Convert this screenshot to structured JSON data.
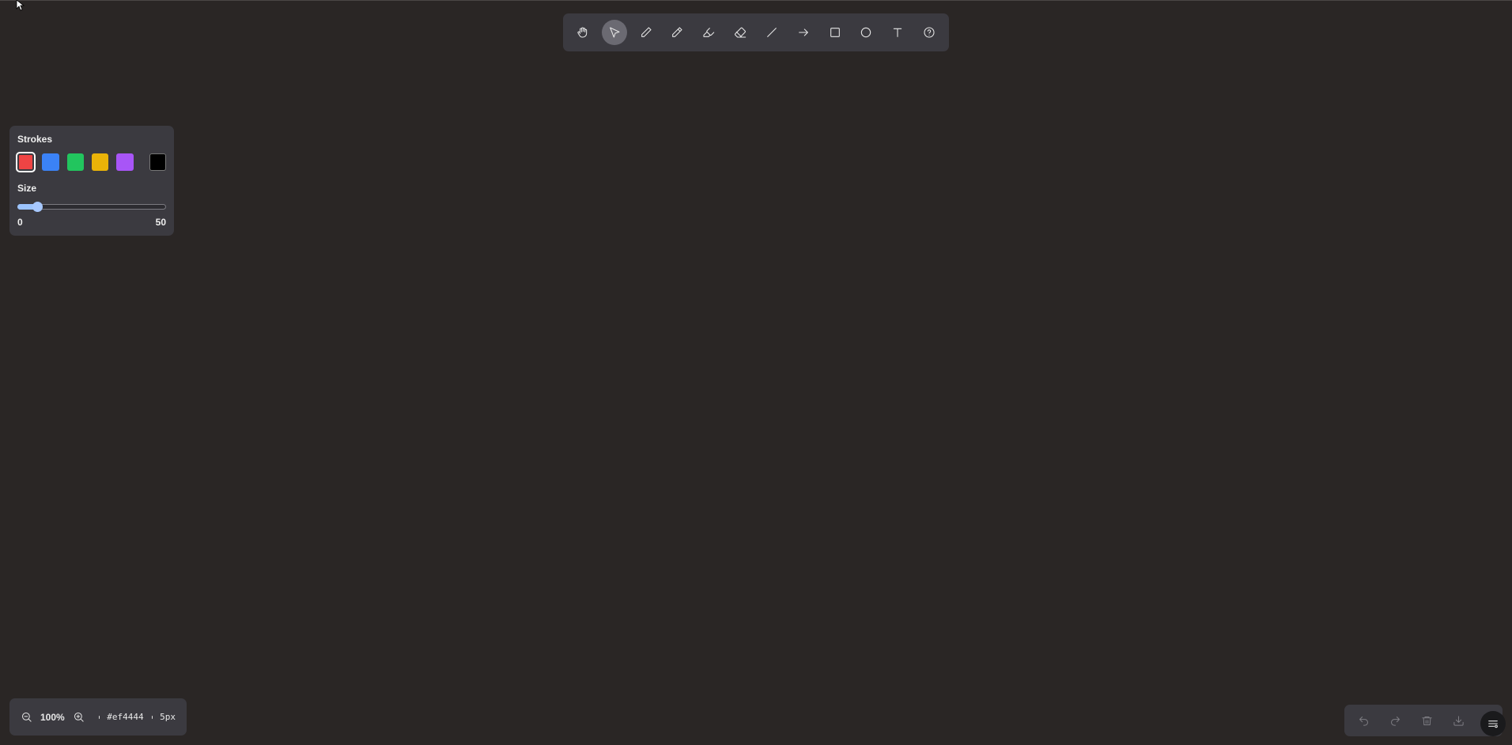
{
  "toolbar": {
    "tools": [
      {
        "name": "hand-icon",
        "active": false
      },
      {
        "name": "select-icon",
        "active": true
      },
      {
        "name": "pen-icon",
        "active": false
      },
      {
        "name": "pencil-icon",
        "active": false
      },
      {
        "name": "highlighter-icon",
        "active": false
      },
      {
        "name": "eraser-icon",
        "active": false
      },
      {
        "name": "line-icon",
        "active": false
      },
      {
        "name": "arrow-icon",
        "active": false
      },
      {
        "name": "rectangle-icon",
        "active": false
      },
      {
        "name": "circle-icon",
        "active": false
      },
      {
        "name": "text-icon",
        "active": false
      },
      {
        "name": "help-icon",
        "active": false
      }
    ]
  },
  "strokes_panel": {
    "title": "Strokes",
    "colors": [
      "#ef4444",
      "#3b82f6",
      "#22c55e",
      "#eab308",
      "#a855f7",
      "#000000"
    ],
    "selected_color": "#ef4444",
    "size_label": "Size",
    "size_min": "0",
    "size_max": "50",
    "size_value": 5
  },
  "status": {
    "zoom": "100%",
    "color": "#ef4444",
    "size": "5px"
  },
  "actions": {
    "items": [
      "undo-icon",
      "redo-icon",
      "trash-icon",
      "download-icon"
    ],
    "settings": "settings-icon"
  }
}
